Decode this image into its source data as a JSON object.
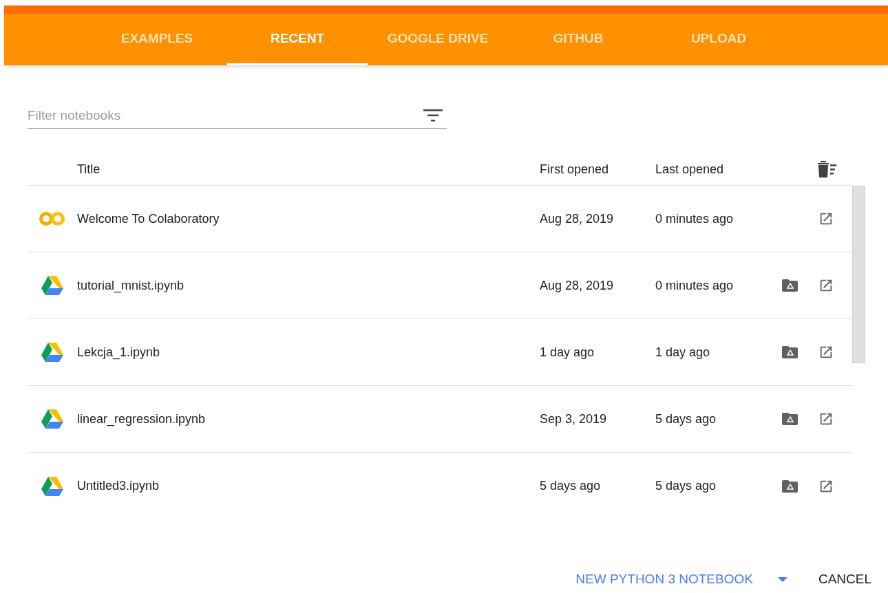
{
  "tabs": [
    {
      "label": "EXAMPLES",
      "selected": false
    },
    {
      "label": "RECENT",
      "selected": true
    },
    {
      "label": "GOOGLE DRIVE",
      "selected": false
    },
    {
      "label": "GITHUB",
      "selected": false
    },
    {
      "label": "UPLOAD",
      "selected": false
    }
  ],
  "filter": {
    "placeholder": "Filter notebooks"
  },
  "table": {
    "columns": [
      "Title",
      "First opened",
      "Last opened"
    ],
    "rows": [
      {
        "kind": "colab",
        "title": "Welcome To Colaboratory",
        "first_opened": "Aug 28, 2019",
        "last_opened": "0 minutes ago",
        "drive_folder": false
      },
      {
        "kind": "drive",
        "title": "tutorial_mnist.ipynb",
        "first_opened": "Aug 28, 2019",
        "last_opened": "0 minutes ago",
        "drive_folder": true
      },
      {
        "kind": "drive",
        "title": "Lekcja_1.ipynb",
        "first_opened": "1 day ago",
        "last_opened": "1 day ago",
        "drive_folder": true
      },
      {
        "kind": "drive",
        "title": "linear_regression.ipynb",
        "first_opened": "Sep 3, 2019",
        "last_opened": "5 days ago",
        "drive_folder": true
      },
      {
        "kind": "drive",
        "title": "Untitled3.ipynb",
        "first_opened": "5 days ago",
        "last_opened": "5 days ago",
        "drive_folder": true
      }
    ]
  },
  "footer": {
    "new_notebook": "NEW PYTHON 3 NOTEBOOK",
    "cancel": "CANCEL"
  }
}
